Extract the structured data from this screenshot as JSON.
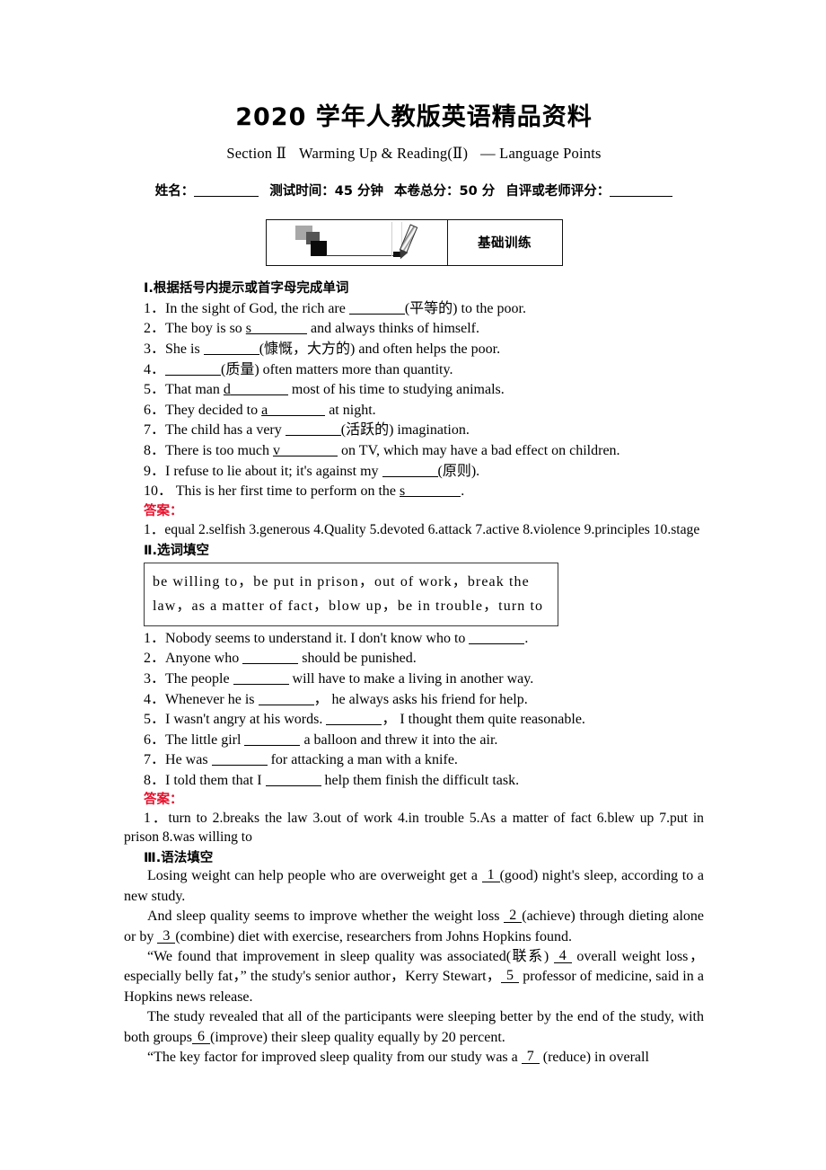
{
  "title": "2020 学年人教版英语精品资料",
  "section_line": {
    "part1": "Section Ⅱ",
    "part2": "Warming Up & Reading(Ⅱ)",
    "part3": "— Language Points"
  },
  "info": {
    "name_label": "姓名：",
    "time_label": "测试时间：45 分钟",
    "total_label": "本卷总分：50 分",
    "score_label": "自评或老师评分："
  },
  "badge": {
    "icon": "pencil-writing-icon",
    "label": "基础训练"
  },
  "exercise1": {
    "heading": "Ⅰ.根据括号内提示或首字母完成单词",
    "items": [
      {
        "num": "1．",
        "pre": "In the sight of God, the rich are ",
        "blank": true,
        "post": "(平等的) to the poor.",
        "lead": ""
      },
      {
        "num": "2．",
        "pre": "The boy is so ",
        "blank": true,
        "post": " and always thinks of himself.",
        "lead": "s"
      },
      {
        "num": "3．",
        "pre": "She is ",
        "blank": true,
        "post": "(慷慨，大方的) and often helps the poor.",
        "lead": ""
      },
      {
        "num": "4．",
        "pre": "",
        "blank": true,
        "post": "(质量) often matters more than quantity.",
        "lead": ""
      },
      {
        "num": "5．",
        "pre": "That man ",
        "blank": true,
        "post": " most of his time to studying animals.",
        "lead": "d"
      },
      {
        "num": "6．",
        "pre": "They decided to ",
        "blank": true,
        "post": " at night.",
        "lead": "a"
      },
      {
        "num": "7．",
        "pre": "The child has a very ",
        "blank": true,
        "post": "(活跃的) imagination.",
        "lead": ""
      },
      {
        "num": "8．",
        "pre": "There is too much ",
        "blank": true,
        "post": " on TV, which may have a bad effect on children.",
        "lead": "v"
      },
      {
        "num": "9．",
        "pre": "I refuse to lie about it; it's against my ",
        "blank": true,
        "post": "(原则).",
        "lead": ""
      },
      {
        "num": "10．",
        "pre": " This is her first time to perform on the ",
        "blank": true,
        "post": ".",
        "lead": "s"
      }
    ],
    "answer_label": "答案：",
    "answers_line1": "1．equal   2.selfish   3.generous   4.Quality   5.devoted   6.attack   7.active   8.violence",
    "answers_line2": "9.principles   10.stage"
  },
  "exercise2": {
    "heading": "Ⅱ.选词填空",
    "word_bank": "be willing to，be put in prison，out of work，break the law，as a matter of fact，blow up，be in trouble，turn to",
    "items": [
      {
        "num": "1．",
        "pre": "Nobody seems to understand it. I don't know who to ",
        "post": "."
      },
      {
        "num": "2．",
        "pre": "Anyone who ",
        "post": " should be punished."
      },
      {
        "num": "3．",
        "pre": "The people ",
        "post": " will have to make a living in another way."
      },
      {
        "num": "4．",
        "pre": "Whenever he is ",
        "post": "，  he always asks his friend for help."
      },
      {
        "num": "5．",
        "pre": "I wasn't angry at his words. ",
        "post": "，  I thought them quite reasonable."
      },
      {
        "num": "6．",
        "pre": "The little girl ",
        "post": " a balloon and threw it into the air."
      },
      {
        "num": "7．",
        "pre": "He was ",
        "post": " for attacking a man with a knife."
      },
      {
        "num": "8．",
        "pre": "I told them that I ",
        "post": " help them finish the difficult task."
      }
    ],
    "answer_label": "答案：",
    "answers_line1": "1．turn to   2.breaks the law   3.out of work   4.in trouble   5.As a matter of fact   6.blew up",
    "answers_line2": "7.put in prison   8.was willing to"
  },
  "exercise3": {
    "heading": "Ⅲ.语法填空",
    "p1_a": "Losing weight can help people who are overweight get a ",
    "p1_b": "1",
    "p1_c": "(good) night's sleep, according to a new study.",
    "p2_a": "And sleep quality seems to improve whether the weight loss ",
    "p2_b": "2",
    "p2_c": "(achieve) through dieting alone or by ",
    "p2_d": "3",
    "p2_e": "(combine) diet with exercise, researchers from Johns Hopkins found.",
    "p3_a": "“We found that improvement in sleep quality was associated(联系) ",
    "p3_b": "4",
    "p3_c": " overall weight loss，especially belly fat，” the study's senior author，Kerry Stewart，",
    "p3_d": "5",
    "p3_e": " professor of medicine, said in a Hopkins news release.",
    "p4_a": "The study revealed that all of the participants were sleeping better by the end of the study, with both groups",
    "p4_b": "6",
    "p4_c": "(improve) their sleep quality equally by 20 percent.",
    "p5_a": "“The key factor for improved sleep quality from our study was a ",
    "p5_b": "7",
    "p5_c": " (reduce) in overall"
  },
  "colors": {
    "answer_red": "#e8112d",
    "ink": "#000000",
    "page_bg": "#ffffff"
  }
}
